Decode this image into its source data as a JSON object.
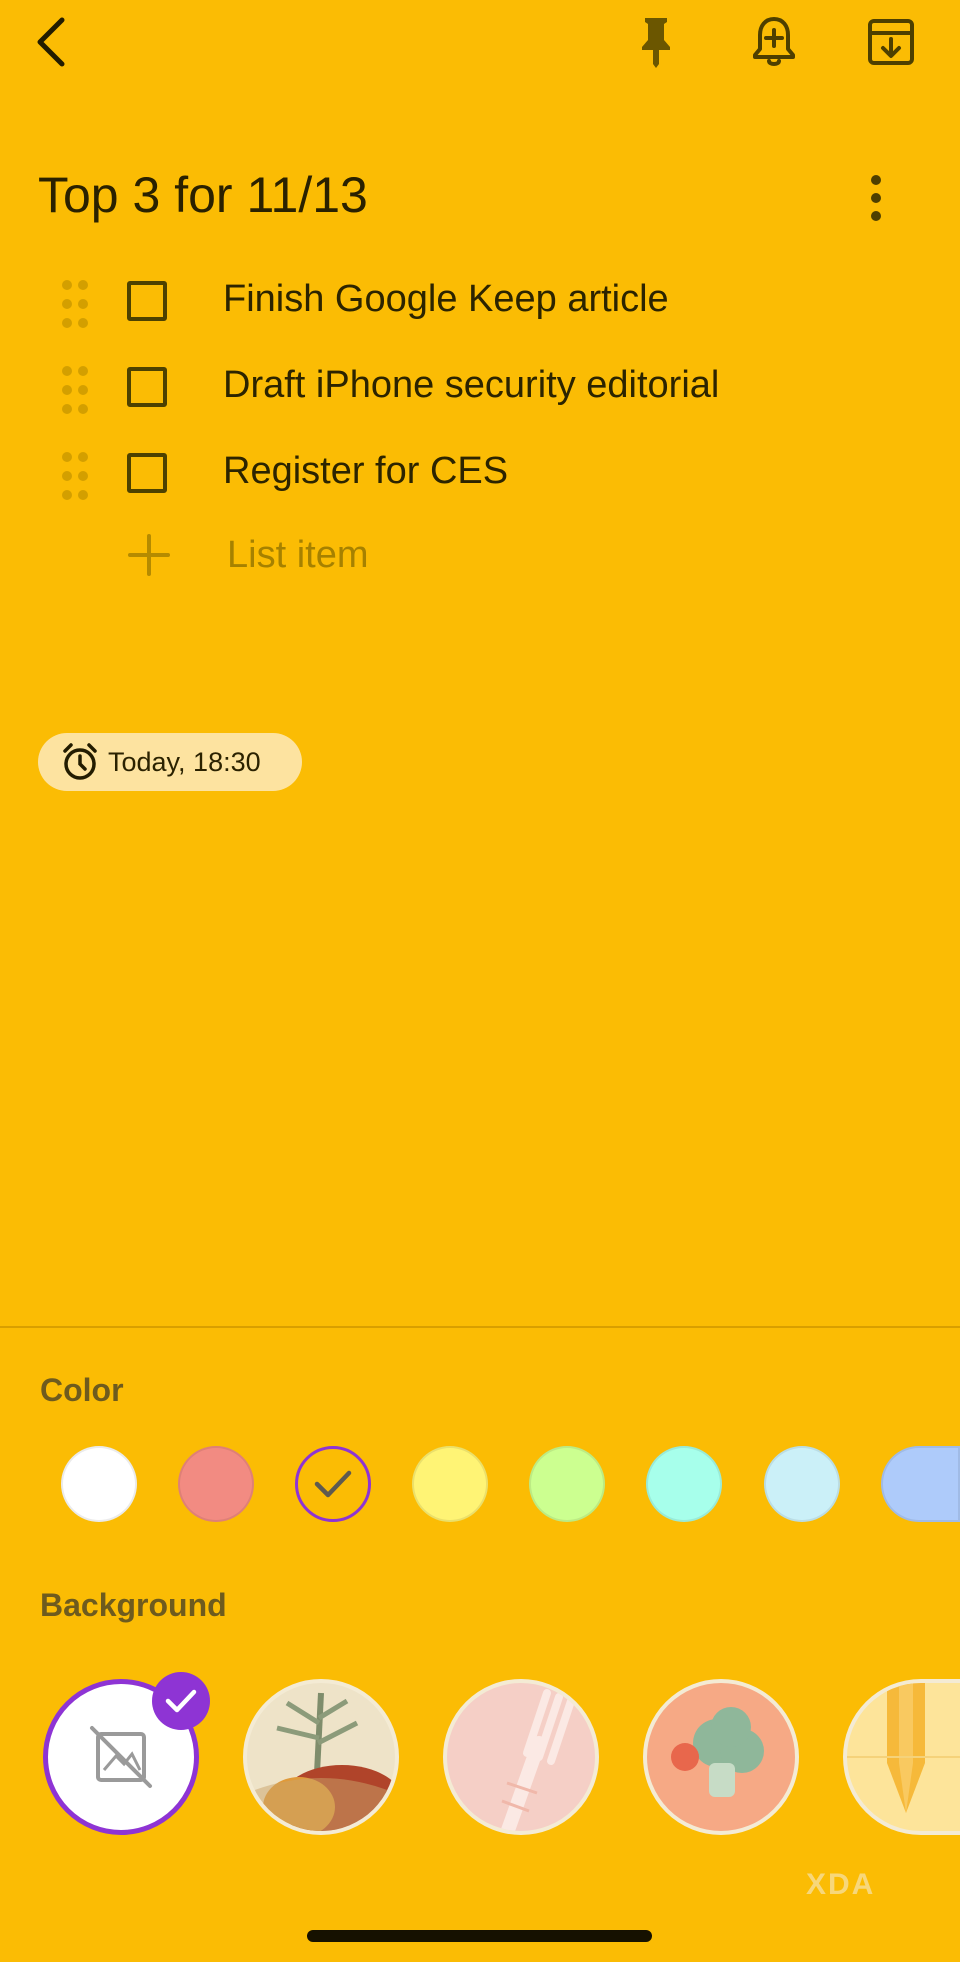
{
  "header": {
    "back_icon": "back-arrow-icon",
    "pin_icon": "pin-icon",
    "reminder_icon": "add-reminder-icon",
    "archive_icon": "archive-icon"
  },
  "note": {
    "title": "Top 3 for 11/13",
    "items": [
      {
        "label": "Finish Google Keep article",
        "checked": false
      },
      {
        "label": "Draft iPhone security editorial",
        "checked": false
      },
      {
        "label": "Register for CES",
        "checked": false
      }
    ],
    "add_placeholder": "List item",
    "reminder": "Today, 18:30"
  },
  "palette": {
    "color_label": "Color",
    "colors": [
      "#FFFFFF",
      "#F28B82",
      "#FBBC04",
      "#FFF475",
      "#CCFF90",
      "#A7FFEB",
      "#CBF0F8",
      "#AECBFA"
    ],
    "selected_index": 2,
    "background_label": "Background",
    "backgrounds": [
      "none",
      "groceries",
      "food",
      "recipes",
      "notes"
    ],
    "selected_background": 0
  },
  "watermark": "XDA",
  "accent": "#8E34D4"
}
